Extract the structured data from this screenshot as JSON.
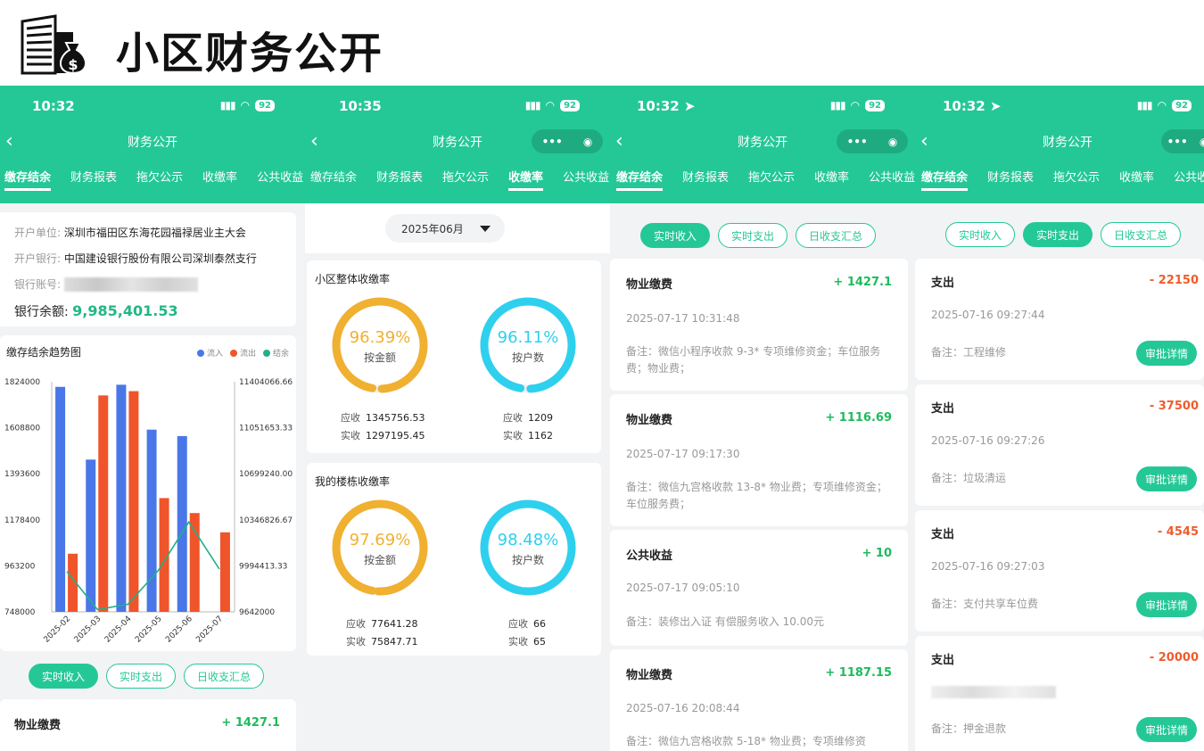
{
  "page": {
    "title": "小区财务公开",
    "logo_icon": "building-money-bag-icon"
  },
  "colors": {
    "brand": "#24c896",
    "inflow": "#4a77e8",
    "outflow": "#f0542a",
    "balance_line": "#20b08a",
    "positive": "#1dbb5c",
    "negative": "#ef5c2c",
    "gauge_amount": "#f0b030",
    "gauge_households": "#2ed0ee"
  },
  "phones": [
    {
      "status": {
        "time": "10:32",
        "battery": "92"
      },
      "nav": {
        "title": "财务公开"
      },
      "tabs": [
        "缴存结余",
        "财务报表",
        "拖欠公示",
        "收缴率",
        "公共收益"
      ],
      "active_tab": 0,
      "account": {
        "unit_label": "开户单位:",
        "unit_value": "深圳市福田区东海花园福禄居业主大会",
        "bank_label": "开户银行:",
        "bank_value": "中国建设银行股份有限公司深圳泰然支行",
        "number_label": "银行账号:",
        "balance_label": "银行余额:",
        "balance_value": "9,985,401.53"
      },
      "trend_chart": {
        "title": "缴存结余趋势图",
        "legend": [
          "流入",
          "流出",
          "结余"
        ]
      },
      "filters": [
        "实时收入",
        "实时支出",
        "日收支汇总"
      ],
      "active_filter": 0,
      "record": {
        "title": "物业缴费",
        "amount": "+ 1427.1"
      }
    },
    {
      "status": {
        "time": "10:35",
        "battery": "92"
      },
      "nav": {
        "title": "财务公开"
      },
      "tabs": [
        "缴存结余",
        "财务报表",
        "拖欠公示",
        "收缴率",
        "公共收益"
      ],
      "active_tab": 3,
      "month": "2025年06月",
      "blocks": [
        {
          "title": "小区整体收缴率",
          "amount_rate": "96.39%",
          "amount_rate_value": 96.39,
          "amount_label": "按金额",
          "household_rate": "96.11%",
          "household_rate_value": 96.11,
          "household_label": "按户数",
          "receivable_label": "应收",
          "received_label": "实收",
          "amount_receivable": "1345756.53",
          "amount_received": "1297195.45",
          "household_receivable": "1209",
          "household_received": "1162"
        },
        {
          "title": "我的楼栋收缴率",
          "amount_rate": "97.69%",
          "amount_rate_value": 97.69,
          "amount_label": "按金额",
          "household_rate": "98.48%",
          "household_rate_value": 98.48,
          "household_label": "按户数",
          "receivable_label": "应收",
          "received_label": "实收",
          "amount_receivable": "77641.28",
          "amount_received": "75847.71",
          "household_receivable": "66",
          "household_received": "65"
        }
      ]
    },
    {
      "status": {
        "time": "10:32",
        "battery": "92"
      },
      "nav": {
        "title": "财务公开"
      },
      "tabs": [
        "缴存结余",
        "财务报表",
        "拖欠公示",
        "收缴率",
        "公共收益"
      ],
      "active_tab": 0,
      "filters": [
        "实时收入",
        "实时支出",
        "日收支汇总"
      ],
      "active_filter": 0,
      "records": [
        {
          "title": "物业缴费",
          "amount": "+ 1427.1",
          "time": "2025-07-17 10:31:48",
          "note": "备注：微信小程序收款 9-3* 专项维修资金；车位服务费；物业费；"
        },
        {
          "title": "物业缴费",
          "amount": "+ 1116.69",
          "time": "2025-07-17 09:17:30",
          "note": "备注：微信九宫格收款 13-8* 物业费；专项维修资金；车位服务费；"
        },
        {
          "title": "公共收益",
          "amount": "+ 10",
          "time": "2025-07-17 09:05:10",
          "note": "备注：装修出入证 有偿服务收入 10.00元"
        },
        {
          "title": "物业缴费",
          "amount": "+ 1187.15",
          "time": "2025-07-16 20:08:44",
          "note": "备注：微信九宫格收款 5-18* 物业费；专项维修资"
        }
      ]
    },
    {
      "status": {
        "time": "10:32",
        "battery": "92"
      },
      "nav": {
        "title": "财务公开"
      },
      "tabs": [
        "缴存结余",
        "财务报表",
        "拖欠公示",
        "收缴率",
        "公共收"
      ],
      "active_tab": 0,
      "filters": [
        "实时收入",
        "实时支出",
        "日收支汇总"
      ],
      "active_filter": 1,
      "approve_label": "审批详情",
      "records": [
        {
          "title": "支出",
          "amount": "- 22150",
          "time": "2025-07-16 09:27:44",
          "note": "备注：工程维修"
        },
        {
          "title": "支出",
          "amount": "- 37500",
          "time": "2025-07-16 09:27:26",
          "note": "备注：垃圾清运"
        },
        {
          "title": "支出",
          "amount": "- 4545",
          "time": "2025-07-16 09:27:03",
          "note": "备注：支付共享车位费"
        },
        {
          "title": "支出",
          "amount": "- 20000",
          "time": "",
          "note": "备注：押金退款"
        }
      ]
    }
  ],
  "chart_data": {
    "type": "bar",
    "title": "缴存结余趋势图",
    "categories": [
      "2025-02",
      "2025-03",
      "2025-04",
      "2025-05",
      "2025-06",
      "2025-07"
    ],
    "left_axis_ticks": [
      "1824000",
      "1608800",
      "1393600",
      "1178400",
      "963200",
      "748000"
    ],
    "right_axis_ticks": [
      "11404066.66",
      "11051653.33",
      "10699240.00",
      "10346826.67",
      "9994413.33",
      "9642000"
    ],
    "ylim_left": [
      748000,
      1824000
    ],
    "ylim_right": [
      9642000,
      11404066.66
    ],
    "series": [
      {
        "name": "流入",
        "type": "bar",
        "axis": "left",
        "values": [
          1800000,
          1460000,
          1810000,
          1600000,
          1570000,
          null
        ]
      },
      {
        "name": "流出",
        "type": "bar",
        "axis": "left",
        "values": [
          1020000,
          1760000,
          1780000,
          1280000,
          1210000,
          1120000
        ]
      },
      {
        "name": "结余",
        "type": "line",
        "axis": "right",
        "values": [
          9950000,
          9660000,
          9700000,
          9960000,
          10330000,
          9970000
        ]
      }
    ],
    "legend_position": "top-right",
    "grid": false
  }
}
